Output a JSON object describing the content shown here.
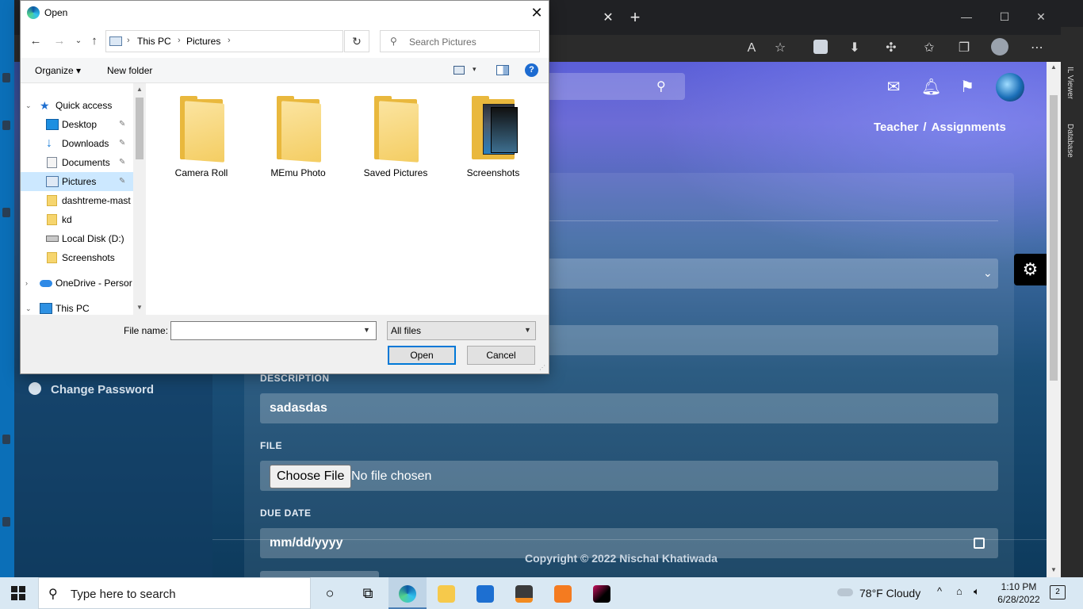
{
  "dialog": {
    "title": "Open",
    "close_glyph": "✕",
    "address": {
      "crumbs": [
        "This PC",
        "Pictures"
      ],
      "chevron": "›",
      "dropdown_glyph": "⌄"
    },
    "refresh_glyph": "↻",
    "search": {
      "placeholder": "Search Pictures",
      "value": ""
    },
    "commands": {
      "organize": "Organize ▾",
      "new_folder": "New folder",
      "view_caret": "▾",
      "help": "?"
    },
    "nav_pane": {
      "items": [
        {
          "label": "Quick access",
          "icon": "star-icon",
          "expander": "⌄",
          "pinned": false,
          "selected": false
        },
        {
          "label": "Desktop",
          "icon": "desktop-icon",
          "pinned": true,
          "selected": false
        },
        {
          "label": "Downloads",
          "icon": "download-icon",
          "pinned": true,
          "selected": false
        },
        {
          "label": "Documents",
          "icon": "documents-icon",
          "pinned": true,
          "selected": false
        },
        {
          "label": "Pictures",
          "icon": "pictures-icon",
          "pinned": true,
          "selected": true
        },
        {
          "label": "dashtreme-mast",
          "icon": "folder-icon",
          "pinned": false,
          "selected": false
        },
        {
          "label": "kd",
          "icon": "folder-icon",
          "pinned": false,
          "selected": false
        },
        {
          "label": "Local Disk (D:)",
          "icon": "drive-icon",
          "pinned": false,
          "selected": false
        },
        {
          "label": "Screenshots",
          "icon": "folder-icon",
          "pinned": false,
          "selected": false
        },
        {
          "label": "OneDrive - Persor",
          "icon": "cloud-icon",
          "expander": "›",
          "pinned": false,
          "selected": false
        },
        {
          "label": "This PC",
          "icon": "computer-icon",
          "expander": "⌄",
          "pinned": false,
          "selected": false
        }
      ],
      "pin_glyph": "📌"
    },
    "files": [
      {
        "name": "Camera Roll",
        "icon": "folder-icon"
      },
      {
        "name": "MEmu Photo",
        "icon": "folder-icon"
      },
      {
        "name": "Saved Pictures",
        "icon": "folder-icon"
      },
      {
        "name": "Screenshots",
        "icon": "folder-with-thumbnail-icon"
      }
    ],
    "file_name_label": "File name:",
    "file_name_value": "",
    "file_type": "All files",
    "open_button": "Open",
    "cancel_button": "Cancel"
  },
  "browser": {
    "tab_close": "✕",
    "new_tab": "+",
    "window_controls": [
      "—",
      "☐",
      "✕"
    ]
  },
  "web": {
    "breadcrumb": [
      "Teacher",
      "Assignments"
    ],
    "breadcrumb_sep": "/",
    "sidebar_item": "Change Password",
    "labels": {
      "description": "DESCRIPTION",
      "file": "FILE",
      "due_date": "DUE DATE"
    },
    "description_value": "sadasdas",
    "choose_file_button": "Choose File",
    "no_file_text": "No file chosen",
    "date_placeholder": "mm/dd/yyyy",
    "copyright": "Copyright © 2022 Nischal Khatiwada",
    "side_panel": [
      "IL Viewer",
      "Database"
    ]
  },
  "taskbar": {
    "search_placeholder": "Type here to search",
    "weather": "78°F  Cloudy",
    "time": "1:10 PM",
    "date": "6/28/2022",
    "notifications": "2"
  },
  "colors": {
    "accent": "#0078d7",
    "selected_nav": "#cce8ff",
    "page_gradient_top": "#5b5fd8",
    "page_gradient_bottom": "#0d3a5c",
    "folder": "#f4cd62"
  }
}
